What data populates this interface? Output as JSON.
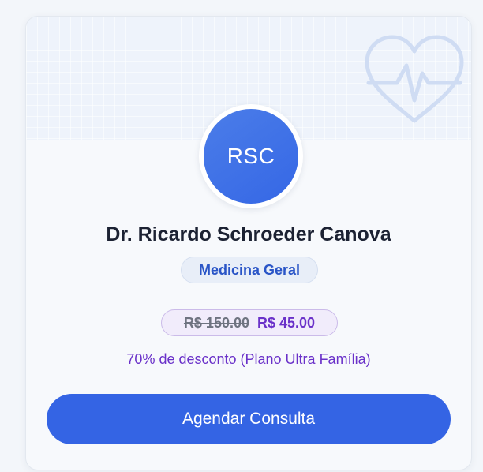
{
  "doctor": {
    "initials": "RSC",
    "name": "Dr. Ricardo Schroeder Canova",
    "specialty": "Medicina Geral"
  },
  "pricing": {
    "original_price": "R$ 150.00",
    "discounted_price": "R$ 45.00",
    "discount_text": "70% de desconto (Plano Ultra Família)"
  },
  "actions": {
    "schedule_label": "Agendar Consulta"
  },
  "icons": {
    "header_decoration": "heart-pulse-icon"
  },
  "colors": {
    "accent": "#3464e4",
    "discount": "#6a31c9",
    "badge_text": "#2a55c7"
  }
}
